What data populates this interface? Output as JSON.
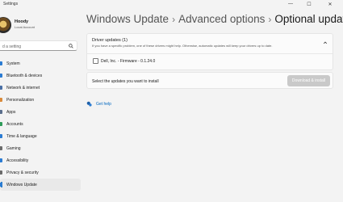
{
  "app": {
    "title": "Settings"
  },
  "window_controls": {
    "minimize": "—",
    "maximize": "☐",
    "close": "✕"
  },
  "user": {
    "name": "Hoody",
    "account_type": "Local Account"
  },
  "search": {
    "placeholder": "d a setting"
  },
  "sidebar": {
    "items": [
      {
        "label": "System",
        "color": "#2b7cd3"
      },
      {
        "label": "Bluetooth & devices",
        "color": "#2b7cd3"
      },
      {
        "label": "Network & internet",
        "color": "#4a6fa5"
      },
      {
        "label": "Personalization",
        "color": "#d98a3a"
      },
      {
        "label": "Apps",
        "color": "#5a6e8c"
      },
      {
        "label": "Accounts",
        "color": "#2f9c5a"
      },
      {
        "label": "Time & language",
        "color": "#2b7cd3"
      },
      {
        "label": "Gaming",
        "color": "#6b6b6b"
      },
      {
        "label": "Accessibility",
        "color": "#2b7cd3"
      },
      {
        "label": "Privacy & security",
        "color": "#6b6b6b"
      },
      {
        "label": "Windows Update",
        "color": "#2b7cd3",
        "active": true
      }
    ]
  },
  "breadcrumb": {
    "item1": "Windows Update",
    "item2": "Advanced options",
    "current": "Optional updates",
    "separator": "›"
  },
  "drivers": {
    "title": "Driver updates (1)",
    "subtitle": "If you have a specific problem, one of these drivers might help. Otherwise, automatic updates will keep your drivers up to date.",
    "items": [
      {
        "label": "Dell, Inc. - Firmware - 0.1.24.0",
        "checked": false
      }
    ]
  },
  "install": {
    "prompt": "Select the updates you want to install",
    "button": "Download & install"
  },
  "help": {
    "label": "Get help"
  },
  "colors": {
    "accent": "#0067c0",
    "disabled_button": "#c9c9c9"
  }
}
